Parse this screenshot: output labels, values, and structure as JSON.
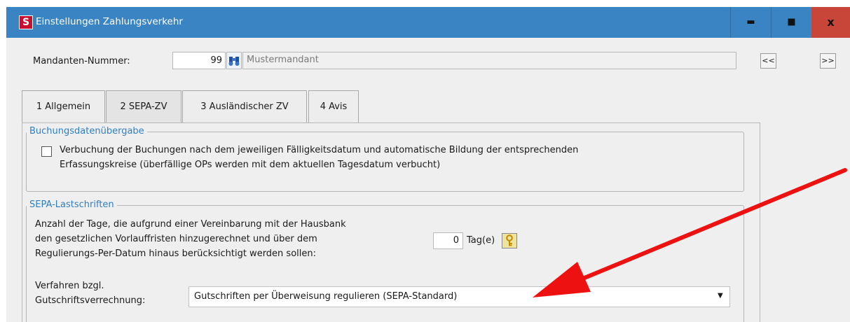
{
  "window": {
    "title": "Einstellungen Zahlungsverkehr",
    "app_icon_letter": "S",
    "minimize": "▬",
    "maximize": "■",
    "close": "x"
  },
  "mandant": {
    "label": "Mandanten-Nummer:",
    "number": "99",
    "name": "Mustermandant",
    "prev": "<<",
    "next": ">>"
  },
  "tabs": [
    {
      "label": "1 Allgemein"
    },
    {
      "label": "2 SEPA-ZV"
    },
    {
      "label": "3 Ausländischer ZV"
    },
    {
      "label": "4 Avis"
    }
  ],
  "active_tab": "2 SEPA-ZV",
  "buchung": {
    "title": "Buchungsdatenübergabe",
    "checkbox_checked": false,
    "line1": "Verbuchung der Buchungen nach dem jeweiligen Fälligkeitsdatum und automatische Bildung der entsprechenden",
    "line2": "Erfassungskreise (überfällige OPs werden mit dem aktuellen Tagesdatum verbucht)"
  },
  "sepa": {
    "title": "SEPA-Lastschriften",
    "days_line1": "Anzahl der Tage, die aufgrund einer Vereinbarung mit der Hausbank",
    "days_line2": "den gesetzlichen Vorlauffristen hinzugerechnet und über dem",
    "days_line3": "Regulierungs-Per-Datum hinaus berücksichtigt werden sollen:",
    "days_value": "0",
    "days_unit": "Tag(e)",
    "verfahren_line1": "Verfahren bzgl.",
    "verfahren_line2": "Gutschriftsverrechnung:",
    "verfahren_value": "Gutschriften per Überweisung regulieren (SEPA-Standard)"
  },
  "colors": {
    "titlebar": "#3a84c4",
    "close_button": "#c8453a",
    "group_title": "#2f7fc0",
    "annotation_arrow": "#ee1111"
  }
}
